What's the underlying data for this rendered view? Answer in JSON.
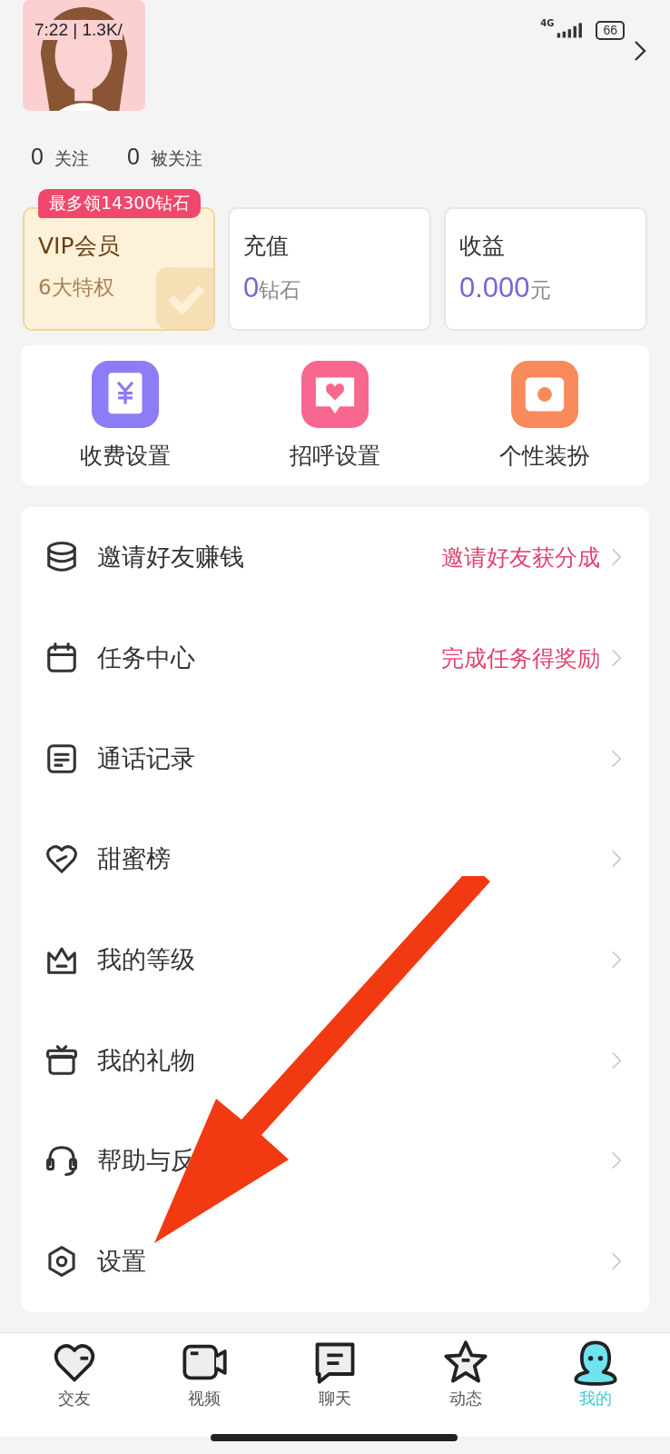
{
  "status_bar": {
    "time": "7:22 | 1.3K/",
    "network": "4G",
    "battery": "66"
  },
  "follow_stats": [
    {
      "count": "0",
      "label": "关注"
    },
    {
      "count": "0",
      "label": "被关注"
    }
  ],
  "promo_tag": "最多领14300钻石",
  "cards": [
    {
      "kind": "vip",
      "title": "VIP会员",
      "subtitle": "6大特权"
    },
    {
      "kind": "balance",
      "title": "充值",
      "value": "0",
      "unit": "钻石"
    },
    {
      "kind": "balance",
      "title": "收益",
      "value": "0.000",
      "unit": "元"
    }
  ],
  "quick_actions": [
    {
      "label": "收费设置",
      "color": "#8c7cf5"
    },
    {
      "label": "招呼设置",
      "color": "#f7678f"
    },
    {
      "label": "个性装扮",
      "color": "#f98a5c"
    }
  ],
  "menu": [
    {
      "label": "邀请好友赚钱",
      "hint": "邀请好友获分成"
    },
    {
      "label": "任务中心",
      "hint": "完成任务得奖励"
    },
    {
      "label": "通话记录"
    },
    {
      "label": "甜蜜榜"
    },
    {
      "label": "我的等级"
    },
    {
      "label": "我的礼物"
    },
    {
      "label": "帮助与反"
    },
    {
      "label": "设置"
    }
  ],
  "tabs": [
    {
      "label": "交友",
      "selected": false
    },
    {
      "label": "视频",
      "selected": false
    },
    {
      "label": "聊天",
      "selected": false
    },
    {
      "label": "动态",
      "selected": false
    },
    {
      "label": "我的",
      "selected": true
    }
  ]
}
